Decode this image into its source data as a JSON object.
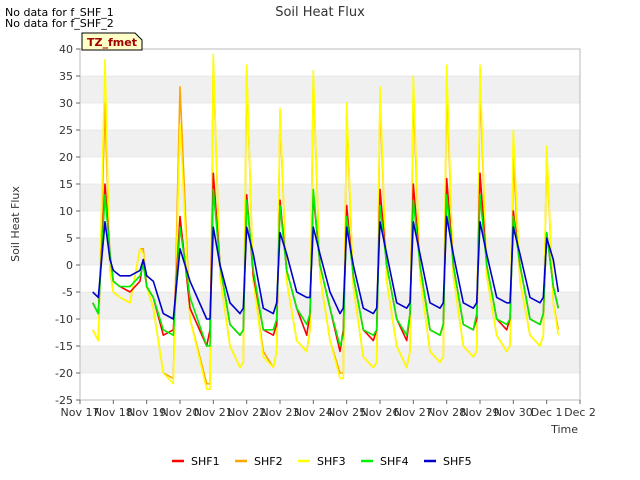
{
  "notes": [
    "No data for f_SHF_1",
    "No data for f_SHF_2"
  ],
  "badge": "TZ_fmet",
  "chart_data": {
    "type": "line",
    "title": "Soil Heat Flux",
    "xlabel": "Time",
    "ylabel": "Soil Heat Flux",
    "ylim": [
      -25,
      40
    ],
    "yticks": [
      -25,
      -20,
      -15,
      -10,
      -5,
      0,
      5,
      10,
      15,
      20,
      25,
      30,
      35,
      40
    ],
    "xlim": [
      "Nov 17",
      "Dec 2"
    ],
    "xticks": [
      "Nov 17",
      "Nov 18",
      "Nov 19",
      "Nov 20",
      "Nov 21",
      "Nov 22",
      "Nov 23",
      "Nov 24",
      "Nov 25",
      "Nov 26",
      "Nov 27",
      "Nov 28",
      "Nov 29",
      "Nov 30",
      "Dec 1",
      "Dec 2"
    ],
    "grid": "horizontal bands",
    "legend_position": "bottom",
    "x_days": [
      0.38,
      0.55,
      0.75,
      0.9,
      1.0,
      1.2,
      1.5,
      1.8,
      1.9,
      2.0,
      2.2,
      2.5,
      2.8,
      3.0,
      3.3,
      3.8,
      3.9,
      4.0,
      4.2,
      4.5,
      4.8,
      4.9,
      5.0,
      5.2,
      5.5,
      5.8,
      5.9,
      6.0,
      6.2,
      6.5,
      6.8,
      6.9,
      7.0,
      7.2,
      7.5,
      7.8,
      7.9,
      8.0,
      8.2,
      8.5,
      8.8,
      8.9,
      9.0,
      9.2,
      9.5,
      9.8,
      9.9,
      10.0,
      10.2,
      10.5,
      10.8,
      10.9,
      11.0,
      11.2,
      11.5,
      11.8,
      11.9,
      12.0,
      12.2,
      12.5,
      12.8,
      12.9,
      13.0,
      13.2,
      13.5,
      13.8,
      13.9,
      14.0,
      14.2,
      14.35
    ],
    "series": [
      {
        "name": "SHF1",
        "color": "#ff0000",
        "values": [
          -7,
          -9,
          15,
          2,
          -3,
          -4,
          -5,
          -3,
          1,
          -4,
          -6,
          -13,
          -12,
          9,
          -8,
          -15,
          -12,
          17,
          0,
          -11,
          -13,
          -12,
          13,
          -2,
          -12,
          -13,
          -11,
          12,
          -1,
          -8,
          -13,
          -9,
          13,
          0,
          -8,
          -16,
          -12,
          11,
          -2,
          -12,
          -14,
          -12,
          14,
          0,
          -10,
          -14,
          -9,
          15,
          0,
          -12,
          -13,
          -11,
          16,
          0,
          -11,
          -12,
          -10,
          17,
          0,
          -10,
          -12,
          -10,
          10,
          0,
          -10,
          -11,
          -9,
          6,
          -4,
          -8
        ]
      },
      {
        "name": "SHF2",
        "color": "#ffa500",
        "values": [
          -12,
          -14,
          30,
          -1,
          -5,
          -6,
          -7,
          3,
          3,
          -4,
          -8,
          -20,
          -21,
          33,
          -10,
          -22,
          -22,
          38,
          -2,
          -15,
          -19,
          -18,
          36,
          -3,
          -16,
          -19,
          -16,
          28,
          -3,
          -14,
          -16,
          -12,
          35,
          -2,
          -14,
          -20,
          -20,
          28,
          -4,
          -17,
          -19,
          -18,
          31,
          -3,
          -15,
          -19,
          -16,
          32,
          -2,
          -16,
          -18,
          -17,
          34,
          -2,
          -15,
          -17,
          -16,
          34,
          -2,
          -13,
          -16,
          -15,
          20,
          -3,
          -13,
          -15,
          -13,
          21,
          -7,
          -12
        ]
      },
      {
        "name": "SHF3",
        "color": "#ffff00",
        "values": [
          -12,
          -14,
          38,
          -1,
          -5,
          -6,
          -7,
          3,
          2,
          -4,
          -8,
          -20,
          -22,
          26,
          -10,
          -23,
          -23,
          39,
          -2,
          -15,
          -19,
          -18,
          37,
          -3,
          -17,
          -19,
          -16,
          29,
          -3,
          -14,
          -16,
          -12,
          36,
          -2,
          -14,
          -21,
          -21,
          30,
          -4,
          -17,
          -19,
          -18,
          33,
          -3,
          -15,
          -19,
          -16,
          35,
          -2,
          -16,
          -18,
          -17,
          37,
          -2,
          -15,
          -17,
          -16,
          37,
          -2,
          -13,
          -16,
          -15,
          25,
          -3,
          -13,
          -15,
          -13,
          22,
          -7,
          -13
        ]
      },
      {
        "name": "SHF4",
        "color": "#00ee00",
        "values": [
          -7,
          -9,
          13,
          2,
          -3,
          -4,
          -4,
          -2,
          0,
          -4,
          -6,
          -12,
          -13,
          7,
          -6,
          -15,
          -15,
          14,
          0,
          -11,
          -13,
          -12,
          12,
          -1,
          -12,
          -12,
          -10,
          11,
          -1,
          -8,
          -11,
          -9,
          14,
          0,
          -8,
          -15,
          -13,
          9,
          -2,
          -12,
          -13,
          -12,
          11,
          0,
          -10,
          -13,
          -9,
          12,
          0,
          -12,
          -13,
          -11,
          13,
          0,
          -11,
          -12,
          -9,
          13,
          0,
          -10,
          -11,
          -10,
          9,
          0,
          -10,
          -11,
          -9,
          6,
          -4,
          -8
        ]
      },
      {
        "name": "SHF5",
        "color": "#0000cc",
        "values": [
          -5,
          -6,
          8,
          1,
          -1,
          -2,
          -2,
          -1,
          1,
          -2,
          -3,
          -9,
          -10,
          3,
          -3,
          -10,
          -10,
          7,
          0,
          -7,
          -9,
          -8,
          7,
          2,
          -8,
          -9,
          -7,
          6,
          2,
          -5,
          -6,
          -6,
          7,
          2,
          -5,
          -9,
          -8,
          7,
          0,
          -8,
          -9,
          -8,
          8,
          2,
          -7,
          -8,
          -7,
          8,
          2,
          -7,
          -8,
          -7,
          9,
          2,
          -7,
          -8,
          -7,
          8,
          2,
          -6,
          -7,
          -7,
          7,
          2,
          -6,
          -7,
          -6,
          5,
          1,
          -5
        ]
      }
    ]
  }
}
